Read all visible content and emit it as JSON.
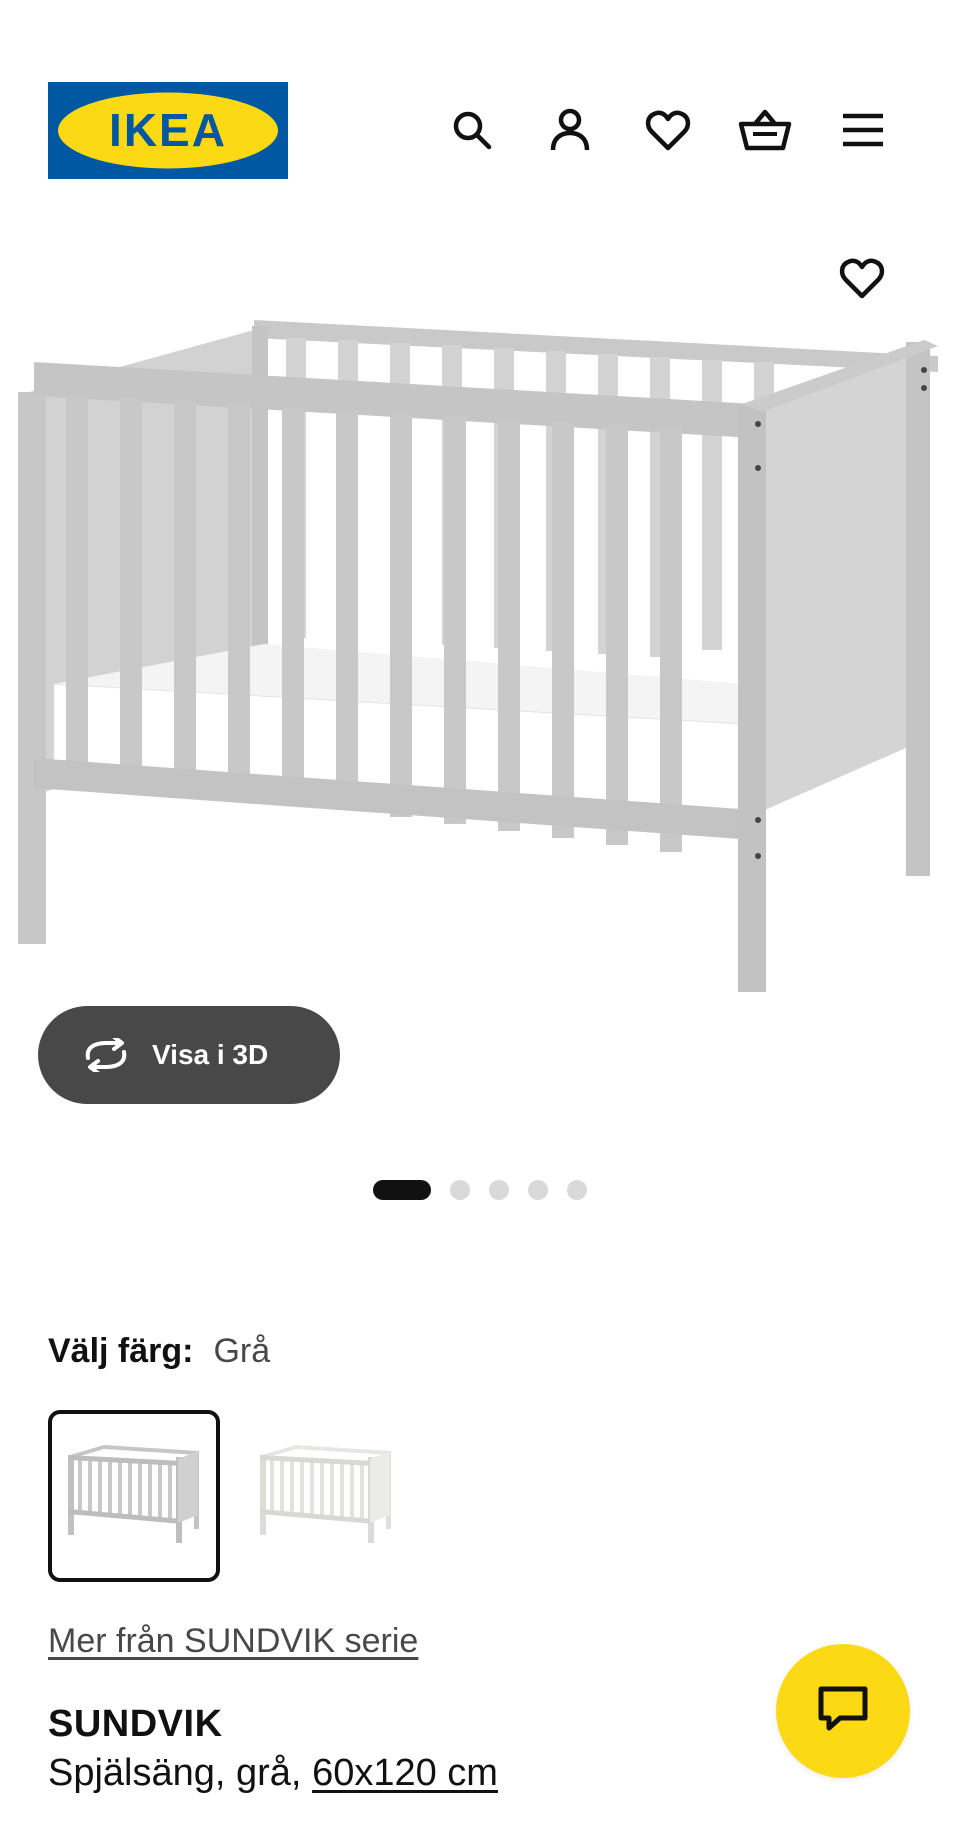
{
  "header": {
    "logo_text": "IKEA",
    "icons": [
      "search-icon",
      "user-icon",
      "heart-icon",
      "basket-icon",
      "menu-icon"
    ]
  },
  "gallery": {
    "favorite_icon": "heart-icon",
    "view_3d_label": "Visa i 3D",
    "view_3d_icon": "rotate-icon",
    "image_count": 5,
    "active_image": 1
  },
  "color": {
    "label": "Välj färg:",
    "value": "Grå",
    "swatches": [
      {
        "name": "Grå",
        "selected": true
      },
      {
        "name": "Vit",
        "selected": false
      }
    ]
  },
  "series_link": "Mer från SUNDVIK serie",
  "product": {
    "name": "SUNDVIK",
    "description": "Spjälsäng, grå,",
    "size": "60x120 cm"
  },
  "colors": {
    "ikea_blue": "#0058A3",
    "ikea_yellow": "#FBD914",
    "dark_pill": "#484848",
    "dot_inactive": "#D9D9D9"
  },
  "chat_icon": "chat-icon"
}
